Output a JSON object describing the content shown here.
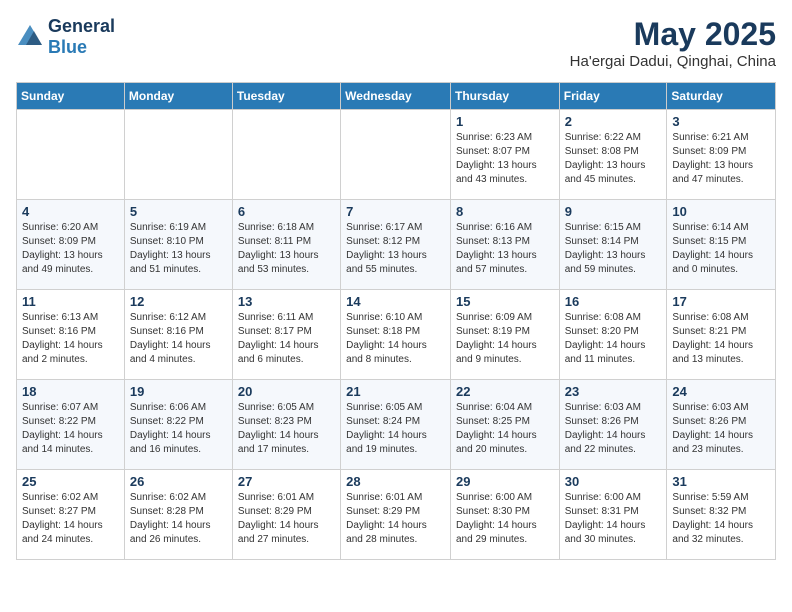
{
  "logo": {
    "general": "General",
    "blue": "Blue"
  },
  "header": {
    "title": "May 2025",
    "subtitle": "Ha'ergai Dadui, Qinghai, China"
  },
  "weekdays": [
    "Sunday",
    "Monday",
    "Tuesday",
    "Wednesday",
    "Thursday",
    "Friday",
    "Saturday"
  ],
  "weeks": [
    [
      {
        "day": "",
        "info": ""
      },
      {
        "day": "",
        "info": ""
      },
      {
        "day": "",
        "info": ""
      },
      {
        "day": "",
        "info": ""
      },
      {
        "day": "1",
        "info": "Sunrise: 6:23 AM\nSunset: 8:07 PM\nDaylight: 13 hours\nand 43 minutes."
      },
      {
        "day": "2",
        "info": "Sunrise: 6:22 AM\nSunset: 8:08 PM\nDaylight: 13 hours\nand 45 minutes."
      },
      {
        "day": "3",
        "info": "Sunrise: 6:21 AM\nSunset: 8:09 PM\nDaylight: 13 hours\nand 47 minutes."
      }
    ],
    [
      {
        "day": "4",
        "info": "Sunrise: 6:20 AM\nSunset: 8:09 PM\nDaylight: 13 hours\nand 49 minutes."
      },
      {
        "day": "5",
        "info": "Sunrise: 6:19 AM\nSunset: 8:10 PM\nDaylight: 13 hours\nand 51 minutes."
      },
      {
        "day": "6",
        "info": "Sunrise: 6:18 AM\nSunset: 8:11 PM\nDaylight: 13 hours\nand 53 minutes."
      },
      {
        "day": "7",
        "info": "Sunrise: 6:17 AM\nSunset: 8:12 PM\nDaylight: 13 hours\nand 55 minutes."
      },
      {
        "day": "8",
        "info": "Sunrise: 6:16 AM\nSunset: 8:13 PM\nDaylight: 13 hours\nand 57 minutes."
      },
      {
        "day": "9",
        "info": "Sunrise: 6:15 AM\nSunset: 8:14 PM\nDaylight: 13 hours\nand 59 minutes."
      },
      {
        "day": "10",
        "info": "Sunrise: 6:14 AM\nSunset: 8:15 PM\nDaylight: 14 hours\nand 0 minutes."
      }
    ],
    [
      {
        "day": "11",
        "info": "Sunrise: 6:13 AM\nSunset: 8:16 PM\nDaylight: 14 hours\nand 2 minutes."
      },
      {
        "day": "12",
        "info": "Sunrise: 6:12 AM\nSunset: 8:16 PM\nDaylight: 14 hours\nand 4 minutes."
      },
      {
        "day": "13",
        "info": "Sunrise: 6:11 AM\nSunset: 8:17 PM\nDaylight: 14 hours\nand 6 minutes."
      },
      {
        "day": "14",
        "info": "Sunrise: 6:10 AM\nSunset: 8:18 PM\nDaylight: 14 hours\nand 8 minutes."
      },
      {
        "day": "15",
        "info": "Sunrise: 6:09 AM\nSunset: 8:19 PM\nDaylight: 14 hours\nand 9 minutes."
      },
      {
        "day": "16",
        "info": "Sunrise: 6:08 AM\nSunset: 8:20 PM\nDaylight: 14 hours\nand 11 minutes."
      },
      {
        "day": "17",
        "info": "Sunrise: 6:08 AM\nSunset: 8:21 PM\nDaylight: 14 hours\nand 13 minutes."
      }
    ],
    [
      {
        "day": "18",
        "info": "Sunrise: 6:07 AM\nSunset: 8:22 PM\nDaylight: 14 hours\nand 14 minutes."
      },
      {
        "day": "19",
        "info": "Sunrise: 6:06 AM\nSunset: 8:22 PM\nDaylight: 14 hours\nand 16 minutes."
      },
      {
        "day": "20",
        "info": "Sunrise: 6:05 AM\nSunset: 8:23 PM\nDaylight: 14 hours\nand 17 minutes."
      },
      {
        "day": "21",
        "info": "Sunrise: 6:05 AM\nSunset: 8:24 PM\nDaylight: 14 hours\nand 19 minutes."
      },
      {
        "day": "22",
        "info": "Sunrise: 6:04 AM\nSunset: 8:25 PM\nDaylight: 14 hours\nand 20 minutes."
      },
      {
        "day": "23",
        "info": "Sunrise: 6:03 AM\nSunset: 8:26 PM\nDaylight: 14 hours\nand 22 minutes."
      },
      {
        "day": "24",
        "info": "Sunrise: 6:03 AM\nSunset: 8:26 PM\nDaylight: 14 hours\nand 23 minutes."
      }
    ],
    [
      {
        "day": "25",
        "info": "Sunrise: 6:02 AM\nSunset: 8:27 PM\nDaylight: 14 hours\nand 24 minutes."
      },
      {
        "day": "26",
        "info": "Sunrise: 6:02 AM\nSunset: 8:28 PM\nDaylight: 14 hours\nand 26 minutes."
      },
      {
        "day": "27",
        "info": "Sunrise: 6:01 AM\nSunset: 8:29 PM\nDaylight: 14 hours\nand 27 minutes."
      },
      {
        "day": "28",
        "info": "Sunrise: 6:01 AM\nSunset: 8:29 PM\nDaylight: 14 hours\nand 28 minutes."
      },
      {
        "day": "29",
        "info": "Sunrise: 6:00 AM\nSunset: 8:30 PM\nDaylight: 14 hours\nand 29 minutes."
      },
      {
        "day": "30",
        "info": "Sunrise: 6:00 AM\nSunset: 8:31 PM\nDaylight: 14 hours\nand 30 minutes."
      },
      {
        "day": "31",
        "info": "Sunrise: 5:59 AM\nSunset: 8:32 PM\nDaylight: 14 hours\nand 32 minutes."
      }
    ]
  ]
}
